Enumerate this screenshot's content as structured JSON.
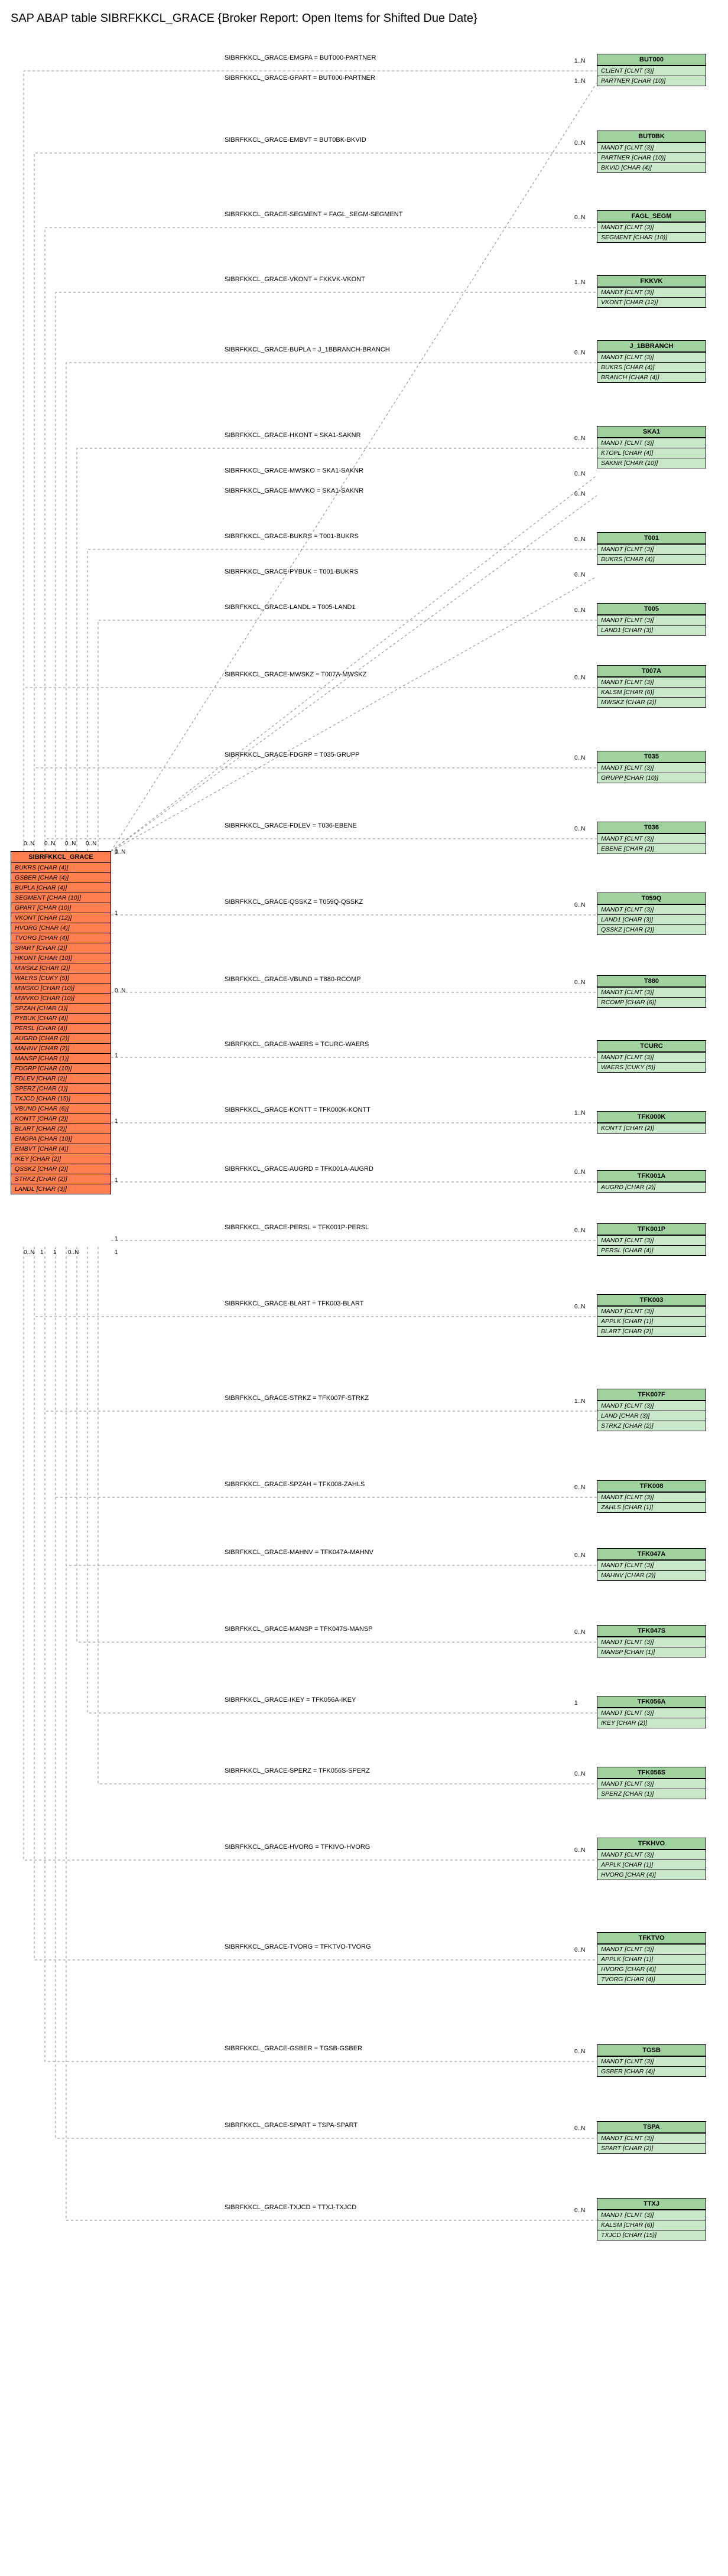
{
  "title": "SAP ABAP table SIBRFKKCL_GRACE {Broker Report: Open Items for Shifted Due Date}",
  "main": {
    "name": "SIBRFKKCL_GRACE",
    "fields": [
      "BUKRS [CHAR (4)]",
      "GSBER [CHAR (4)]",
      "BUPLA [CHAR (4)]",
      "SEGMENT [CHAR (10)]",
      "GPART [CHAR (10)]",
      "VKONT [CHAR (12)]",
      "HVORG [CHAR (4)]",
      "TVORG [CHAR (4)]",
      "SPART [CHAR (2)]",
      "HKONT [CHAR (10)]",
      "MWSKZ [CHAR (2)]",
      "WAERS [CUKY (5)]",
      "MWSKO [CHAR (10)]",
      "MWVKO [CHAR (10)]",
      "SPZAH [CHAR (1)]",
      "PYBUK [CHAR (4)]",
      "PERSL [CHAR (4)]",
      "AUGRD [CHAR (2)]",
      "MAHNV [CHAR (2)]",
      "MANSP [CHAR (1)]",
      "FDGRP [CHAR (10)]",
      "FDLEV [CHAR (2)]",
      "SPERZ [CHAR (1)]",
      "TXJCD [CHAR (15)]",
      "VBUND [CHAR (6)]",
      "KONTT [CHAR (2)]",
      "BLART [CHAR (2)]",
      "EMGPA [CHAR (10)]",
      "EMBVT [CHAR (4)]",
      "IKEY [CHAR (2)]",
      "QSSKZ [CHAR (2)]",
      "STRKZ [CHAR (2)]",
      "LANDL [CHAR (3)]"
    ]
  },
  "targets": [
    {
      "name": "BUT000",
      "fields": [
        "CLIENT [CLNT (3)]",
        "PARTNER [CHAR (10)]"
      ],
      "edge": "SIBRFKKCL_GRACE-EMGPA = BUT000-PARTNER",
      "card_left": "0..N",
      "card_right": "1..N",
      "extra_edge": "SIBRFKKCL_GRACE-GPART = BUT000-PARTNER"
    },
    {
      "name": "BUT0BK",
      "fields": [
        "MANDT [CLNT (3)]",
        "PARTNER [CHAR (10)]",
        "BKVID [CHAR (4)]"
      ],
      "edge": "SIBRFKKCL_GRACE-EMBVT = BUT0BK-BKVID",
      "card_left": "",
      "card_right": "0..N"
    },
    {
      "name": "FAGL_SEGM",
      "fields": [
        "MANDT [CLNT (3)]",
        "SEGMENT [CHAR (10)]"
      ],
      "edge": "SIBRFKKCL_GRACE-SEGMENT = FAGL_SEGM-SEGMENT",
      "card_left": "",
      "card_right": "0..N"
    },
    {
      "name": "FKKVK",
      "fields": [
        "MANDT [CLNT (3)]",
        "VKONT [CHAR (12)]"
      ],
      "edge": "SIBRFKKCL_GRACE-VKONT = FKKVK-VKONT",
      "card_left": "",
      "card_right": "1..N"
    },
    {
      "name": "J_1BBRANCH",
      "fields": [
        "MANDT [CLNT (3)]",
        "BUKRS [CHAR (4)]",
        "BRANCH [CHAR (4)]"
      ],
      "edge": "SIBRFKKCL_GRACE-BUPLA = J_1BBRANCH-BRANCH",
      "card_left": "",
      "card_right": "0..N"
    },
    {
      "name": "SKA1",
      "fields": [
        "MANDT [CLNT (3)]",
        "KTOPL [CHAR (4)]",
        "SAKNR [CHAR (10)]"
      ],
      "edge": "SIBRFKKCL_GRACE-HKONT = SKA1-SAKNR",
      "card_left": "",
      "card_right": "0..N",
      "extra1": "SIBRFKKCL_GRACE-MWSKO = SKA1-SAKNR",
      "extra2": "SIBRFKKCL_GRACE-MWVKO = SKA1-SAKNR",
      "extra_card1": "0..N",
      "extra_card2": "0..N"
    },
    {
      "name": "T001",
      "fields": [
        "MANDT [CLNT (3)]",
        "BUKRS [CHAR (4)]"
      ],
      "edge": "SIBRFKKCL_GRACE-BUKRS = T001-BUKRS",
      "card_left": "",
      "card_right": "0..N",
      "extra1": "SIBRFKKCL_GRACE-PYBUK = T001-BUKRS",
      "extra_card1": "0..N"
    },
    {
      "name": "T005",
      "fields": [
        "MANDT [CLNT (3)]",
        "LAND1 [CHAR (3)]"
      ],
      "edge": "SIBRFKKCL_GRACE-LANDL = T005-LAND1",
      "card_left": "",
      "card_right": "0..N"
    },
    {
      "name": "T007A",
      "fields": [
        "MANDT [CLNT (3)]",
        "KALSM [CHAR (6)]",
        "MWSKZ [CHAR (2)]"
      ],
      "edge": "SIBRFKKCL_GRACE-MWSKZ = T007A-MWSKZ",
      "card_left": "",
      "card_right": "0..N"
    },
    {
      "name": "T035",
      "fields": [
        "MANDT [CLNT (3)]",
        "GRUPP [CHAR (10)]"
      ],
      "edge": "SIBRFKKCL_GRACE-FDGRP = T035-GRUPP",
      "card_left": "1",
      "card_right": "0..N"
    },
    {
      "name": "T036",
      "fields": [
        "MANDT [CLNT (3)]",
        "EBENE [CHAR (2)]"
      ],
      "edge": "SIBRFKKCL_GRACE-FDLEV = T036-EBENE",
      "card_left": "1",
      "card_right": "0..N"
    },
    {
      "name": "T059Q",
      "fields": [
        "MANDT [CLNT (3)]",
        "LAND1 [CHAR (3)]",
        "QSSKZ [CHAR (2)]"
      ],
      "edge": "SIBRFKKCL_GRACE-QSSKZ = T059Q-QSSKZ",
      "card_left": "1",
      "card_right": "0..N"
    },
    {
      "name": "T880",
      "fields": [
        "MANDT [CLNT (3)]",
        "RCOMP [CHAR (6)]"
      ],
      "edge": "SIBRFKKCL_GRACE-VBUND = T880-RCOMP",
      "card_left": "0..N",
      "card_right": "0..N"
    },
    {
      "name": "TCURC",
      "fields": [
        "MANDT [CLNT (3)]",
        "WAERS [CUKY (5)]"
      ],
      "edge": "SIBRFKKCL_GRACE-WAERS = TCURC-WAERS",
      "card_left": "1",
      "card_right": ""
    },
    {
      "name": "TFK000K",
      "fields": [
        "KONTT [CHAR (2)]"
      ],
      "edge": "SIBRFKKCL_GRACE-KONTT = TFK000K-KONTT",
      "card_left": "1",
      "card_right": "1..N"
    },
    {
      "name": "TFK001A",
      "fields": [
        "AUGRD [CHAR (2)]"
      ],
      "edge": "SIBRFKKCL_GRACE-AUGRD = TFK001A-AUGRD",
      "card_left": "1",
      "card_right": "0..N"
    },
    {
      "name": "TFK001P",
      "fields": [
        "MANDT [CLNT (3)]",
        "PERSL [CHAR (4)]"
      ],
      "edge": "SIBRFKKCL_GRACE-PERSL = TFK001P-PERSL",
      "card_left": "1",
      "card_right": "0..N"
    },
    {
      "name": "TFK003",
      "fields": [
        "MANDT [CLNT (3)]",
        "APPLK [CHAR (1)]",
        "BLART [CHAR (2)]"
      ],
      "edge": "SIBRFKKCL_GRACE-BLART = TFK003-BLART",
      "card_left": "1",
      "card_right": "0..N"
    },
    {
      "name": "TFK007F",
      "fields": [
        "MANDT [CLNT (3)]",
        "LAND [CHAR (3)]",
        "STRKZ [CHAR (2)]"
      ],
      "edge": "SIBRFKKCL_GRACE-STRKZ = TFK007F-STRKZ",
      "card_left": "",
      "card_right": "1..N"
    },
    {
      "name": "TFK008",
      "fields": [
        "MANDT [CLNT (3)]",
        "ZAHLS [CHAR (1)]"
      ],
      "edge": "SIBRFKKCL_GRACE-SPZAH = TFK008-ZAHLS",
      "card_left": "",
      "card_right": "0..N"
    },
    {
      "name": "TFK047A",
      "fields": [
        "MANDT [CLNT (3)]",
        "MAHNV [CHAR (2)]"
      ],
      "edge": "SIBRFKKCL_GRACE-MAHNV = TFK047A-MAHNV",
      "card_left": "",
      "card_right": "0..N"
    },
    {
      "name": "TFK047S",
      "fields": [
        "MANDT [CLNT (3)]",
        "MANSP [CHAR (1)]"
      ],
      "edge": "SIBRFKKCL_GRACE-MANSP = TFK047S-MANSP",
      "card_left": "",
      "card_right": "0..N"
    },
    {
      "name": "TFK056A",
      "fields": [
        "MANDT [CLNT (3)]",
        "IKEY [CHAR (2)]"
      ],
      "edge": "SIBRFKKCL_GRACE-IKEY = TFK056A-IKEY",
      "card_left": "",
      "card_right": "1"
    },
    {
      "name": "TFK056S",
      "fields": [
        "MANDT [CLNT (3)]",
        "SPERZ [CHAR (1)]"
      ],
      "edge": "SIBRFKKCL_GRACE-SPERZ = TFK056S-SPERZ",
      "card_left": "",
      "card_right": "0..N"
    },
    {
      "name": "TFKHVO",
      "fields": [
        "MANDT [CLNT (3)]",
        "APPLK [CHAR (1)]",
        "HVORG [CHAR (4)]"
      ],
      "edge": "SIBRFKKCL_GRACE-HVORG = TFKIVO-HVORG",
      "card_left": "",
      "card_right": "0..N"
    },
    {
      "name": "TFKTVO",
      "fields": [
        "MANDT [CLNT (3)]",
        "APPLK [CHAR (1)]",
        "HVORG [CHAR (4)]",
        "TVORG [CHAR (4)]"
      ],
      "edge": "SIBRFKKCL_GRACE-TVORG = TFKTVO-TVORG",
      "card_left": "",
      "card_right": "0..N"
    },
    {
      "name": "TGSB",
      "fields": [
        "MANDT [CLNT (3)]",
        "GSBER [CHAR (4)]"
      ],
      "edge": "SIBRFKKCL_GRACE-GSBER = TGSB-GSBER",
      "card_left": "",
      "card_right": "0..N"
    },
    {
      "name": "TSPA",
      "fields": [
        "MANDT [CLNT (3)]",
        "SPART [CHAR (2)]"
      ],
      "edge": "SIBRFKKCL_GRACE-SPART = TSPA-SPART",
      "card_left": "",
      "card_right": "0..N"
    },
    {
      "name": "TTXJ",
      "fields": [
        "MANDT [CLNT (3)]",
        "KALSM [CHAR (6)]",
        "TXJCD [CHAR (15)]"
      ],
      "edge": "SIBRFKKCL_GRACE-TXJCD = TTXJ-TXJCD",
      "card_left": "",
      "card_right": "0..N"
    }
  ],
  "left_cards": [
    "0..N",
    "0..N",
    "0..N",
    "0..N"
  ],
  "bottom_cards": [
    "0..N",
    "1",
    "1",
    "0..N"
  ]
}
